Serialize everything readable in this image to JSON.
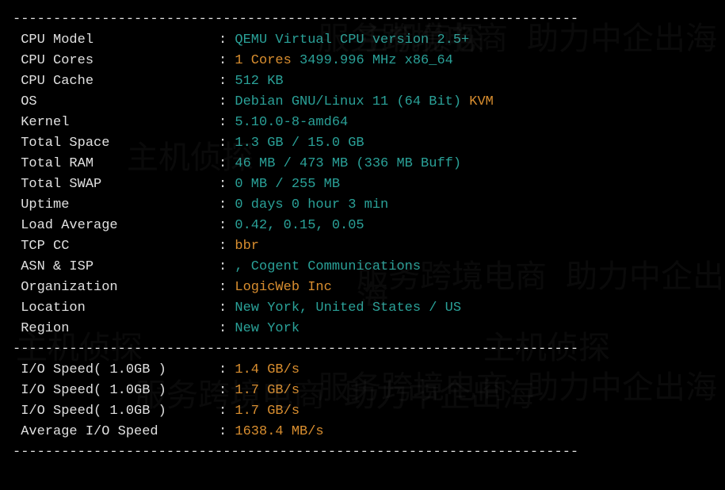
{
  "divider": "----------------------------------------------------------------------",
  "rows1": [
    {
      "label": "CPU Model",
      "pad": "               ",
      "segs": [
        {
          "text": "QEMU Virtual CPU version 2.5+",
          "color": "cyan"
        }
      ]
    },
    {
      "label": "CPU Cores",
      "pad": "               ",
      "segs": [
        {
          "text": "1 Cores ",
          "color": "orange"
        },
        {
          "text": "3499.996 MHz x86_64",
          "color": "cyan"
        }
      ]
    },
    {
      "label": "CPU Cache",
      "pad": "               ",
      "segs": [
        {
          "text": "512 KB",
          "color": "cyan"
        }
      ]
    },
    {
      "label": "OS",
      "pad": "                      ",
      "segs": [
        {
          "text": "Debian GNU/Linux 11 (64 Bit) ",
          "color": "cyan"
        },
        {
          "text": "KVM",
          "color": "orange"
        }
      ]
    },
    {
      "label": "Kernel",
      "pad": "                  ",
      "segs": [
        {
          "text": "5.10.0-8-amd64",
          "color": "cyan"
        }
      ]
    },
    {
      "label": "Total Space",
      "pad": "             ",
      "segs": [
        {
          "text": "1.3 GB / 15.0 GB",
          "color": "cyan"
        }
      ]
    },
    {
      "label": "Total RAM",
      "pad": "               ",
      "segs": [
        {
          "text": "46 MB / 473 MB (336 MB Buff)",
          "color": "cyan"
        }
      ]
    },
    {
      "label": "Total SWAP",
      "pad": "              ",
      "segs": [
        {
          "text": "0 MB / 255 MB",
          "color": "cyan"
        }
      ]
    },
    {
      "label": "Uptime",
      "pad": "                  ",
      "segs": [
        {
          "text": "0 days 0 hour 3 min",
          "color": "cyan"
        }
      ]
    },
    {
      "label": "Load Average",
      "pad": "            ",
      "segs": [
        {
          "text": "0.42, 0.15, 0.05",
          "color": "cyan"
        }
      ]
    },
    {
      "label": "TCP CC",
      "pad": "                  ",
      "segs": [
        {
          "text": "bbr",
          "color": "orange"
        }
      ]
    },
    {
      "label": "ASN & ISP",
      "pad": "               ",
      "segs": [
        {
          "text": ", Cogent Communications",
          "color": "cyan"
        }
      ]
    },
    {
      "label": "Organization",
      "pad": "            ",
      "segs": [
        {
          "text": "LogicWeb Inc",
          "color": "orange"
        }
      ]
    },
    {
      "label": "Location",
      "pad": "                ",
      "segs": [
        {
          "text": "New York, United States / US",
          "color": "cyan"
        }
      ]
    },
    {
      "label": "Region",
      "pad": "                  ",
      "segs": [
        {
          "text": "New York",
          "color": "cyan"
        }
      ]
    }
  ],
  "rows2": [
    {
      "label": "I/O Speed( 1.0GB )",
      "pad": "     ",
      "segs": [
        {
          "text": "1.4 GB/s",
          "color": "orange"
        }
      ]
    },
    {
      "label": "I/O Speed( 1.0GB )",
      "pad": "     ",
      "segs": [
        {
          "text": "1.7 GB/s",
          "color": "orange"
        }
      ]
    },
    {
      "label": "I/O Speed( 1.0GB )",
      "pad": "     ",
      "segs": [
        {
          "text": "1.7 GB/s",
          "color": "orange"
        }
      ]
    },
    {
      "label": "Average I/O Speed",
      "pad": "      ",
      "segs": [
        {
          "text": "1638.4 MB/s",
          "color": "orange"
        }
      ]
    }
  ],
  "watermarks": {
    "cn1": "服务跨境电商 助力中企出海",
    "cn2": "主机侦探"
  }
}
